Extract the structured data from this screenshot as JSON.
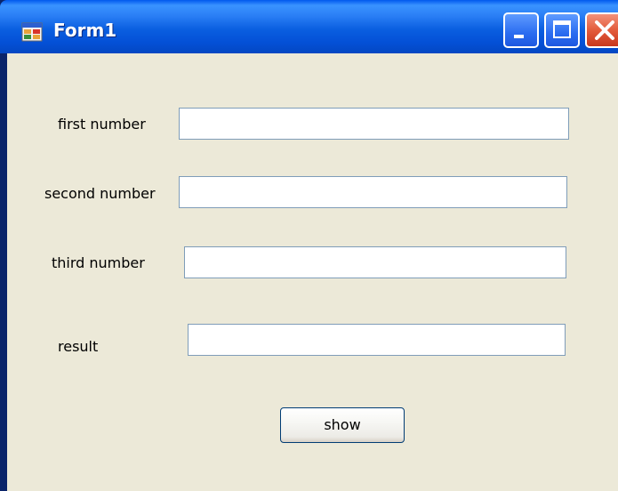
{
  "window": {
    "title": "Form1",
    "titlebar_color": "#0450d6",
    "close_button_color": "#e35b3b",
    "client_background": "#ece9d8",
    "icons": {
      "app": "form-app-icon",
      "minimize": "minimize-icon",
      "maximize": "maximize-icon",
      "close": "close-icon"
    }
  },
  "form": {
    "first_label": "first number",
    "first_value": "",
    "second_label": "second number",
    "second_value": "",
    "third_label": "third number",
    "third_value": "",
    "result_label": "result",
    "result_value": "",
    "show_button": "show"
  }
}
